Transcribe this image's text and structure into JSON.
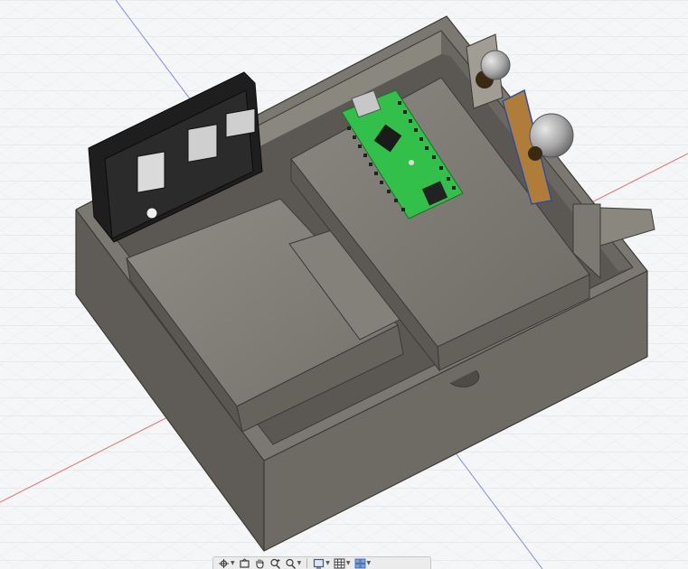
{
  "viewport": {
    "background_color": "#f5f6f7",
    "grid_color": "#d4d6d8",
    "axis_x_color": "#e05555",
    "axis_y_color": "#6677dd",
    "body_color": "#77746d",
    "board_color": "#33c04a"
  },
  "nav_toolbar": {
    "items": [
      {
        "icon": "orbit-icon",
        "has_menu": true
      },
      {
        "icon": "look-at-icon",
        "has_menu": false
      },
      {
        "icon": "pan-hand-icon",
        "has_menu": false
      },
      {
        "icon": "zoom-icon",
        "has_menu": false
      },
      {
        "icon": "fit-window-icon",
        "has_menu": true
      },
      {
        "icon": "display-settings-icon",
        "has_menu": true
      },
      {
        "icon": "grid-snap-icon",
        "has_menu": true
      },
      {
        "icon": "viewports-icon",
        "has_menu": true
      }
    ]
  }
}
